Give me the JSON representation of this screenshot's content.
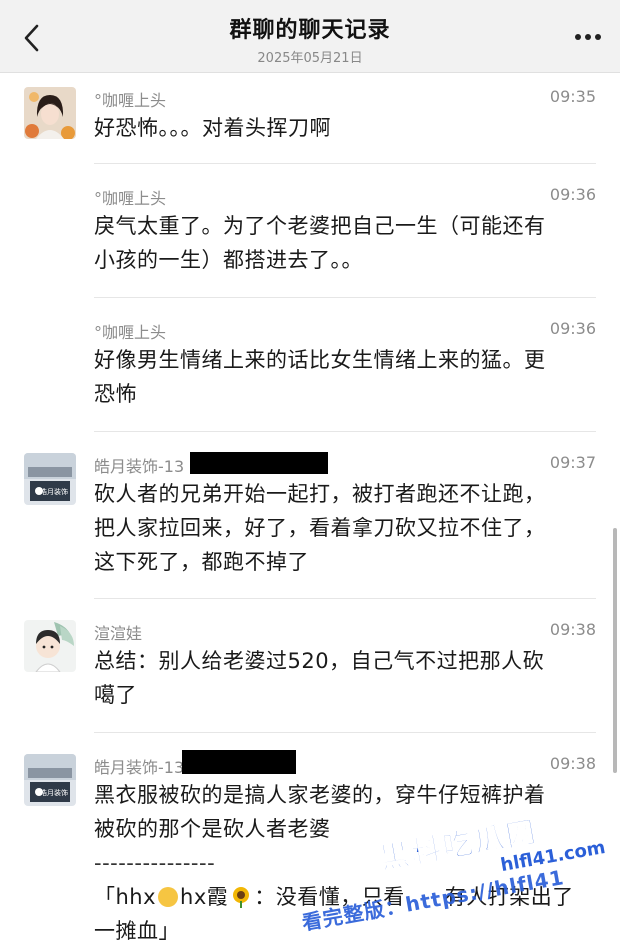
{
  "header": {
    "title": "群聊的聊天记录",
    "date": "2025年05月21日"
  },
  "messages": [
    {
      "sender": "°咖喱上头",
      "time": "09:35",
      "lines": [
        "好恐怖。。。对着头挥刀啊"
      ]
    },
    {
      "sender": "°咖喱上头",
      "time": "09:36",
      "lines": [
        "戾气太重了。为了个老婆把自己一生（可能还有",
        "小孩的一生）都搭进去了。。"
      ]
    },
    {
      "sender": "°咖喱上头",
      "time": "09:36",
      "lines": [
        "好像男生情绪上来的话比女生情绪上来的猛。更",
        "恐怖"
      ]
    },
    {
      "sender": "皓月装饰-13",
      "time": "09:37",
      "lines": [
        "砍人者的兄弟开始一起打，被打者跑还不让跑，",
        "把人家拉回来，好了，看着拿刀砍又拉不住了，",
        "这下死了，都跑不掉了"
      ]
    },
    {
      "sender": "渲渲娃",
      "time": "09:38",
      "lines": [
        "总结：别人给老婆过520，自己气不过把那人砍",
        "噶了"
      ]
    },
    {
      "sender": "皓月装饰-13",
      "time": "09:38",
      "lines": [
        "黑衣服被砍的是搞人家老婆的，穿牛仔短裤护着",
        "被砍的那个是砍人者老婆",
        "---------------"
      ],
      "quote": {
        "open": "「",
        "name1": "hhx",
        "name2": "hx霞",
        "body": "：没看懂，只看",
        "tail": "有人打架出了",
        "line2": "一摊血」"
      }
    }
  ],
  "avatars": {
    "haoyue_logo": "皓月装饰"
  },
  "watermark": {
    "brand": "黑料吃瓜网",
    "url": "hlfl41.com",
    "line": "看完整版：https://hlfl41"
  }
}
